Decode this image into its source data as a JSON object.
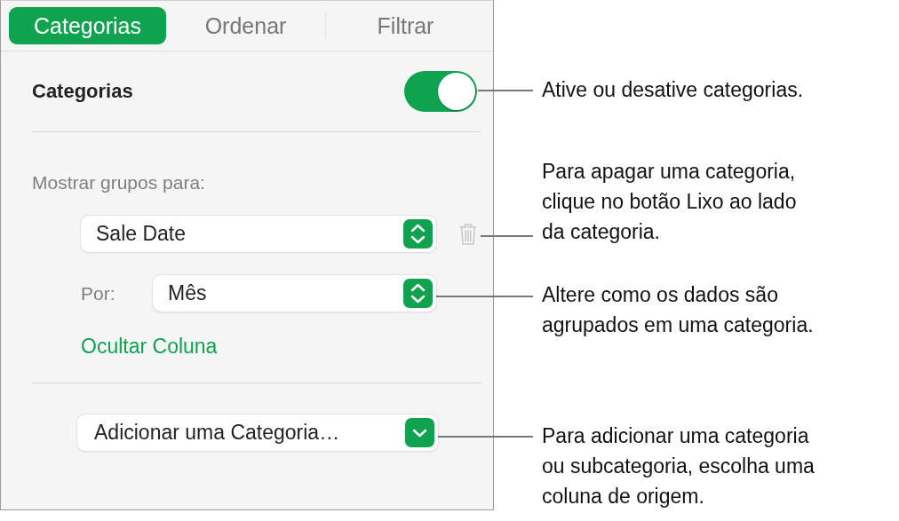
{
  "tabs": [
    {
      "label": "Categorias",
      "selected": true
    },
    {
      "label": "Ordenar",
      "selected": false
    },
    {
      "label": "Filtrar",
      "selected": false
    }
  ],
  "section": {
    "title": "Categorias",
    "on": true
  },
  "group_label": "Mostrar grupos para:",
  "group_popup": {
    "value": "Sale Date"
  },
  "by": {
    "label": "Por:",
    "value": "Mês"
  },
  "hide_link": "Ocultar Coluna",
  "add_popup": {
    "value": "Adicionar uma Categoria…"
  },
  "callouts": [
    {
      "text": "Ative ou desative categorias."
    },
    {
      "text": "Para apagar uma categoria,\nclique no botão Lixo ao lado\nda categoria."
    },
    {
      "text": "Altere como os dados são\nagrupados em uma categoria."
    },
    {
      "text": "Para adicionar uma categoria\nou subcategoria, escolha uma\ncoluna de origem."
    }
  ]
}
